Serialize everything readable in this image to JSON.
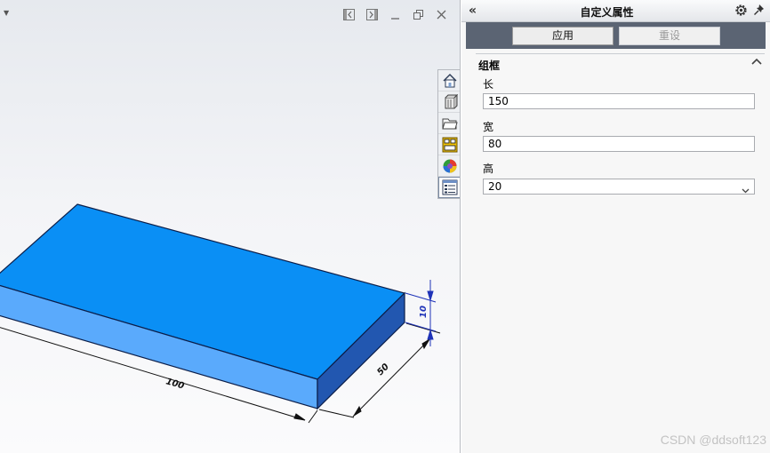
{
  "viewport": {
    "dimensions": {
      "length_label": "100",
      "width_label": "50",
      "height_label": "10"
    },
    "toolbar_icons": [
      "home-icon",
      "parts-icon",
      "folder-icon",
      "design-library-icon",
      "appearance-icon",
      "custom-properties-icon"
    ],
    "colors": {
      "top": "#0a8ff5",
      "front": "#5aaafc",
      "side": "#2257b0",
      "edge": "#0b1e4a",
      "dimension": "#1f33b8"
    }
  },
  "panel": {
    "title": "自定义属性",
    "collapse_label": "«",
    "apply_label": "应用",
    "reset_label": "重设",
    "group": {
      "title": "组框",
      "fields": [
        {
          "label": "长",
          "value": "150"
        },
        {
          "label": "宽",
          "value": "80"
        },
        {
          "label": "高",
          "value": "20"
        }
      ]
    }
  },
  "watermark": "CSDN @ddsoft123"
}
